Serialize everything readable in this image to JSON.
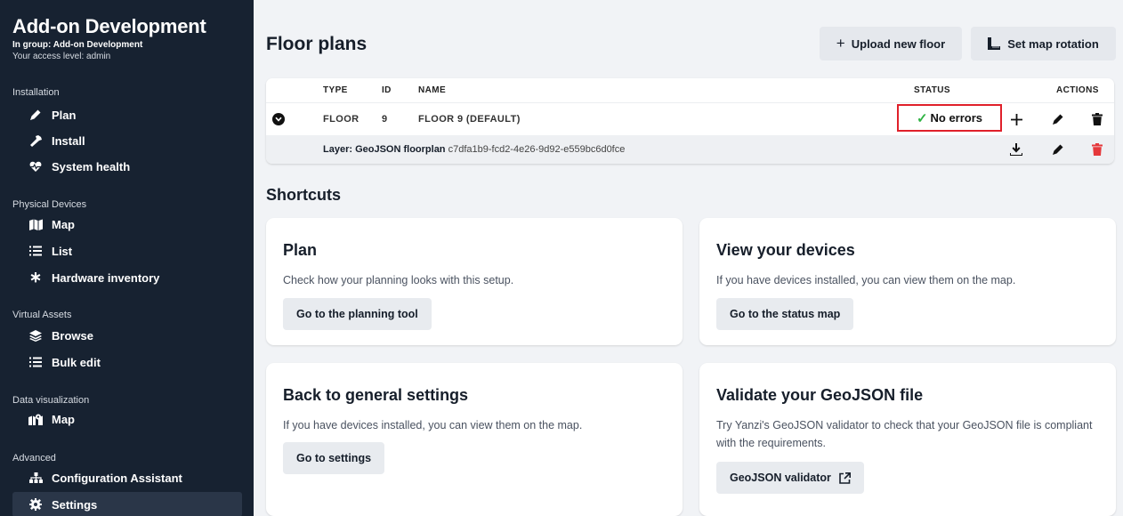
{
  "sidebar": {
    "title": "Add-on Development",
    "group_label": "In group: Add-on Development",
    "access_label": "Your access level: admin",
    "sections": {
      "installation": "Installation",
      "physical": "Physical Devices",
      "virtual": "Virtual Assets",
      "dataviz": "Data visualization",
      "advanced": "Advanced"
    },
    "items": [
      {
        "label": "Plan",
        "icon": "pencil-icon"
      },
      {
        "label": "Install",
        "icon": "wrench-icon"
      },
      {
        "label": "System health",
        "icon": "heartbeat-icon"
      },
      {
        "label": "Map",
        "icon": "map-icon"
      },
      {
        "label": "List",
        "icon": "list-icon"
      },
      {
        "label": "Hardware inventory",
        "icon": "asterisk-icon"
      },
      {
        "label": "Browse",
        "icon": "layers-icon"
      },
      {
        "label": "Bulk edit",
        "icon": "list-icon"
      },
      {
        "label": "Map",
        "icon": "map-marker-icon"
      },
      {
        "label": "Configuration Assistant",
        "icon": "sitemap-icon"
      },
      {
        "label": "Settings",
        "icon": "gear-icon",
        "active": true
      }
    ]
  },
  "main": {
    "title": "Floor plans",
    "upload_label": "Upload new floor",
    "rotation_label": "Set map rotation",
    "table": {
      "headers": {
        "type": "TYPE",
        "id": "ID",
        "name": "NAME",
        "status": "STATUS",
        "actions": "ACTIONS"
      },
      "floor_row": {
        "type": "FLOOR",
        "id": "9",
        "name": "FLOOR 9 (DEFAULT)",
        "status": "No errors"
      },
      "layer_row": {
        "label": "Layer: GeoJSON floorplan",
        "uuid": "c7dfa1b9-fcd2-4e26-9d92-e559bc6d0fce"
      }
    },
    "shortcuts_title": "Shortcuts",
    "cards": [
      {
        "title": "Plan",
        "desc": "Check how your planning looks with this setup.",
        "button": "Go to the planning tool"
      },
      {
        "title": "View your devices",
        "desc": "If you have devices installed, you can view them on the map.",
        "button": "Go to the status map"
      },
      {
        "title": "Back to general settings",
        "desc": "If you have devices installed, you can view them on the map.",
        "button": "Go to settings"
      },
      {
        "title": "Validate your GeoJSON file",
        "desc": "Try Yanzi's GeoJSON validator to check that your GeoJSON file is compliant with the requirements.",
        "button": "GeoJSON validator"
      }
    ]
  },
  "colors": {
    "sidebar_bg": "#172231",
    "status_highlight": "#e0202a",
    "success": "#2fb344",
    "danger": "#e5383b"
  }
}
